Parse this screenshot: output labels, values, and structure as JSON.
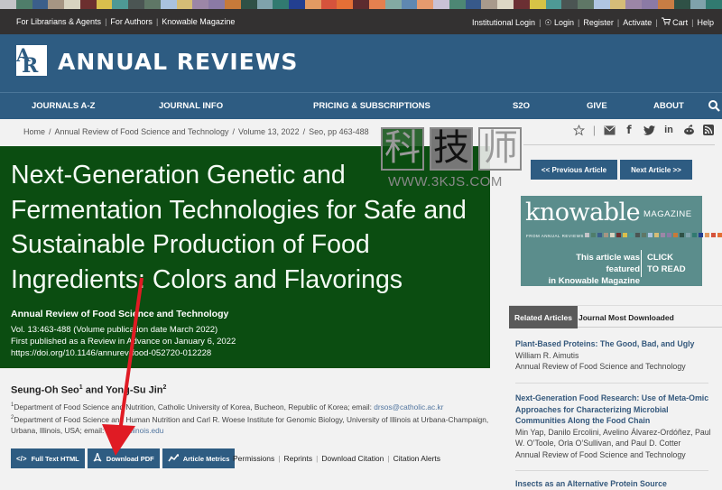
{
  "stripe_colors": [
    "#c4c4c8",
    "#4f7d6a",
    "#3b5f8b",
    "#a69583",
    "#d8d3c0",
    "#6c2f2f",
    "#d9bf4d",
    "#4e9995",
    "#4b5553",
    "#5f7766",
    "#a9c2df",
    "#d5bd76",
    "#9c86a7",
    "#8b7aa5",
    "#c77a3a",
    "#2f5146",
    "#7fa2ab",
    "#317a70",
    "#233f91",
    "#e39a62",
    "#d5533c",
    "#e46f36",
    "#5c2b2f",
    "#e4804f",
    "#83aaa3",
    "#5f88b1",
    "#e69a6e",
    "#c9c1d5",
    "#4d8774",
    "#37598a",
    "#a89a8c",
    "#ddd7c5",
    "#6b2f33",
    "#d7c346",
    "#4e9995",
    "#4b5553",
    "#5f7766",
    "#b0c6e2",
    "#d6bd78",
    "#9c86a7",
    "#8b7aa5",
    "#c87d44",
    "#2f5146",
    "#7fa2ab",
    "#317a70"
  ],
  "utility": {
    "left_links": [
      "For Librarians & Agents",
      "For Authors",
      "Knowable Magazine"
    ],
    "right_links": [
      {
        "label": "Institutional Login",
        "icon": ""
      },
      {
        "label": "Login",
        "icon": "user-circle-icon"
      },
      {
        "label": "Register",
        "icon": ""
      },
      {
        "label": "Activate",
        "icon": ""
      },
      {
        "label": "Cart",
        "icon": "cart-icon"
      },
      {
        "label": "Help",
        "icon": ""
      }
    ]
  },
  "header": {
    "brand": "ANNUAL REVIEWS",
    "logo_letters": [
      "A",
      "R"
    ]
  },
  "nav": {
    "items": [
      "JOURNALS A-Z",
      "JOURNAL INFO",
      "PRICING & SUBSCRIPTIONS",
      "S2O",
      "GIVE",
      "ABOUT"
    ],
    "search_icon": "search-icon"
  },
  "breadcrumb": [
    "Home",
    "Annual Review of Food Science and Technology",
    "Volume 13, 2022",
    "Seo, pp 463-488"
  ],
  "share_icons": [
    "star-icon",
    "email-icon",
    "facebook-icon",
    "twitter-icon",
    "linkedin-icon",
    "reddit-icon",
    "rss-icon"
  ],
  "watermark": {
    "chars": [
      "科",
      "技",
      "师"
    ],
    "url": "WWW.3KJS.COM"
  },
  "article": {
    "title": "Next-Generation Genetic and Fermentation Technologies for Safe and Sustainable Production of Food Ingredients: Colors and Flavorings",
    "journal": "Annual Review of Food Science and Technology",
    "volume_line": "Vol. 13:463-488 (Volume publication date March 2022)",
    "published_line": "First published as a Review in Advance on January 6, 2022",
    "doi": "https://doi.org/10.1146/annurev-food-052720-012228",
    "authors": [
      {
        "name": "Seung-Oh Seo",
        "sup": "1"
      },
      {
        "name": "Yong-Su Jin",
        "sup": "2"
      }
    ],
    "authors_joiner": " and ",
    "affiliations": [
      {
        "sup": "1",
        "text": "Department of Food Science and Nutrition, Catholic University of Korea, Bucheon, Republic of Korea; email: ",
        "email": "drsos@catholic.ac.kr"
      },
      {
        "sup": "2",
        "text": "Department of Food Science and Human Nutrition and Carl R. Woese Institute for Genomic Biology, University of Illinois at Urbana-Champaign, Urbana, Illinois, USA; email: ",
        "email": "ysjin@illinois.edu"
      }
    ]
  },
  "actions": {
    "buttons": [
      {
        "label": "Full Text HTML",
        "icon": "code-icon"
      },
      {
        "label": "Download PDF",
        "icon": "pdf-icon"
      },
      {
        "label": "Article Metrics",
        "icon": "metrics-icon"
      }
    ],
    "links": [
      "Permissions",
      "Reprints",
      "Download Citation",
      "Citation Alerts"
    ]
  },
  "pager": {
    "prev": "<< Previous Article",
    "next": "Next Article >>"
  },
  "knowable": {
    "wordmark": "knowable",
    "magazine": "MAGAZINE",
    "from": "FROM ANNUAL REVIEWS",
    "featured_line1": "This article was featured",
    "featured_line2": "in Knowable Magazine",
    "cta_line1": "CLICK",
    "cta_line2": "TO READ"
  },
  "sidebar": {
    "tabs": [
      {
        "label": "Related Articles",
        "active": true
      },
      {
        "label": "Journal Most Downloaded",
        "active": false
      }
    ],
    "articles": [
      {
        "title": "Plant-Based Proteins: The Good, Bad, and Ugly",
        "authors": "William R. Aimutis",
        "journal": "Annual Review of Food Science and Technology"
      },
      {
        "title": "Next-Generation Food Research: Use of Meta-Omic Approaches for Characterizing Microbial Communities Along the Food Chain",
        "authors": "Min Yap, Danilo Ercolini, Avelino Álvarez-Ordóñez, Paul W. O’Toole, Orla O’Sullivan, and Paul D. Cotter",
        "journal": "Annual Review of Food Science and Technology"
      },
      {
        "title": "Insects as an Alternative Protein Source",
        "authors": "",
        "journal": ""
      }
    ]
  },
  "colors": {
    "brand_blue": "#2e5c82",
    "hero_green": "#0b4d11",
    "knowable_teal": "#5b8d8c",
    "annotation_arrow": "#e01b24"
  }
}
